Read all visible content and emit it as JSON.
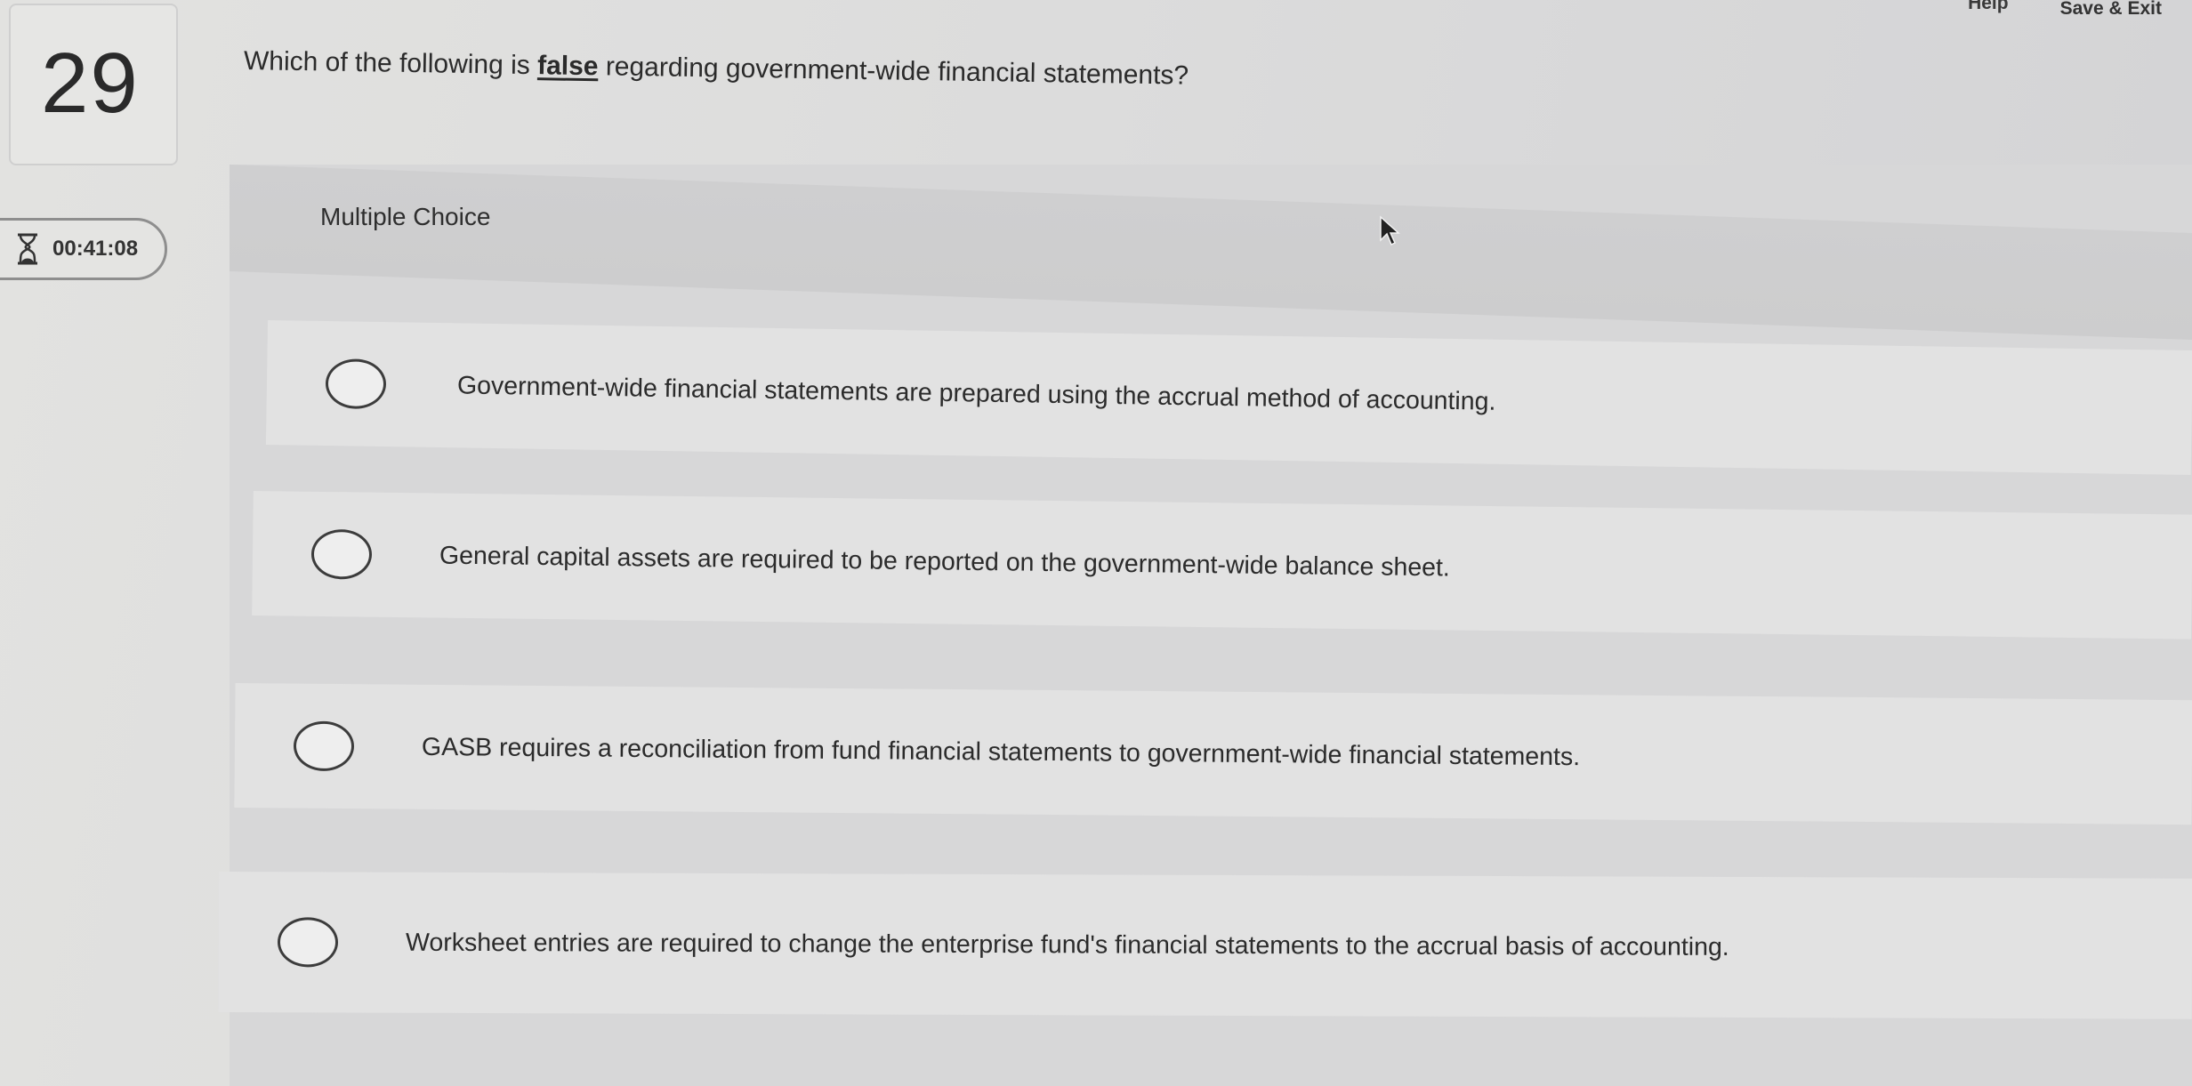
{
  "header": {
    "help_label": "Help",
    "save_exit_label": "Save & Exit"
  },
  "question": {
    "number": "29",
    "prompt_before": "Which of the following is ",
    "prompt_emphasis": "false",
    "prompt_after": " regarding government-wide financial statements?",
    "type_label": "Multiple Choice"
  },
  "timer": {
    "icon": "hourglass-icon",
    "value": "00:41:08"
  },
  "options": [
    {
      "text": "Government-wide financial statements are prepared using the accrual method of accounting."
    },
    {
      "text": "General capital assets are required to be reported on the government-wide balance sheet."
    },
    {
      "text": "GASB requires a reconciliation from fund financial statements to government-wide financial statements."
    },
    {
      "text": "Worksheet entries are required to change the enterprise fund's financial statements to the accrual basis of accounting."
    }
  ]
}
